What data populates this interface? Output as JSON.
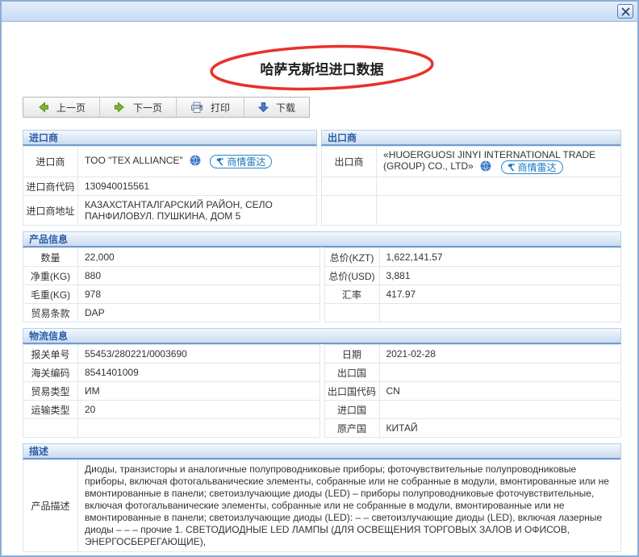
{
  "window": {
    "title_bar": "",
    "close": "close"
  },
  "page_title": "哈萨克斯坦进口数据",
  "toolbar": {
    "prev_label": "上一页",
    "next_label": "下一页",
    "print_label": "打印",
    "download_label": "下载"
  },
  "badge_label": "商情雷达",
  "colors": {
    "accent_blue": "#2b5da8",
    "header_bg": "#cadcf1",
    "highlight_red": "#e8312b",
    "badge_blue": "#1878be",
    "arrow_green": "#7db72f",
    "arrow_blue": "#4a7bd0"
  },
  "importer": {
    "header": "进口商",
    "name_label": "进口商",
    "name_value": "TOO \"TEX ALLIANCE\"",
    "code_label": "进口商代码",
    "code_value": "130940015561",
    "addr_label": "进口商地址",
    "addr_value": "КАЗАХСТАНТАЛГАРСКИЙ РАЙОН, СЕЛО ПАНФИЛОВУЛ. ПУШКИНА, ДОМ 5"
  },
  "exporter": {
    "header": "出口商",
    "name_label": "出口商",
    "name_value": "«HUOERGUOSI JINYI INTERNATIONAL TRADE (GROUP) CO., LTD»",
    "row2_label": "",
    "row2_value": "",
    "row3_label": "",
    "row3_value": ""
  },
  "product": {
    "header": "产品信息",
    "left_rows": [
      {
        "label": "数量",
        "value": "22,000"
      },
      {
        "label": "净重(KG)",
        "value": "880"
      },
      {
        "label": "毛重(KG)",
        "value": "978"
      },
      {
        "label": "贸易条款",
        "value": "DAP"
      }
    ],
    "right_rows": [
      {
        "label": "总价(KZT)",
        "value": "1,622,141.57"
      },
      {
        "label": "总价(USD)",
        "value": "3,881"
      },
      {
        "label": "汇率",
        "value": "417.97"
      },
      {
        "label": "",
        "value": ""
      }
    ]
  },
  "logistics": {
    "header": "物流信息",
    "left_rows": [
      {
        "label": "报关单号",
        "value": "55453/280221/0003690"
      },
      {
        "label": "海关编码",
        "value": "8541401009"
      },
      {
        "label": "贸易类型",
        "value": "ИМ"
      },
      {
        "label": "运输类型",
        "value": "20"
      },
      {
        "label": "",
        "value": ""
      }
    ],
    "right_rows": [
      {
        "label": "日期",
        "value": "2021-02-28"
      },
      {
        "label": "出口国",
        "value": ""
      },
      {
        "label": "出口国代码",
        "value": "CN"
      },
      {
        "label": "进口国",
        "value": ""
      },
      {
        "label": "原产国",
        "value": "КИТАЙ"
      }
    ]
  },
  "description": {
    "header": "描述",
    "label": "产品描述",
    "value": "Диоды, транзисторы и аналогичные полупроводниковые приборы; фоточувствительные полупроводниковые приборы, включая фотогальванические элементы, собранные или не собранные в модули, вмонтированные или не вмонтированные в панели; светоизлучающие диоды (LED) – приборы полупроводниковые фоточувствительные, включая фотогальванические элементы, собранные или не собранные в модули, вмонтированные или не вмонтированные в панели; светоизлучающие диоды (LED): – – светоизлучающие диоды (LED), включая лазерные диоды – – – прочие 1. СВЕТОДИОДНЫЕ LED ЛАМПЫ (ДЛЯ ОСВЕЩЕНИЯ ТОРГОВЫХ ЗАЛОВ И ОФИСОВ, ЭНЕРГОСБЕРЕГАЮЩИЕ),"
  }
}
